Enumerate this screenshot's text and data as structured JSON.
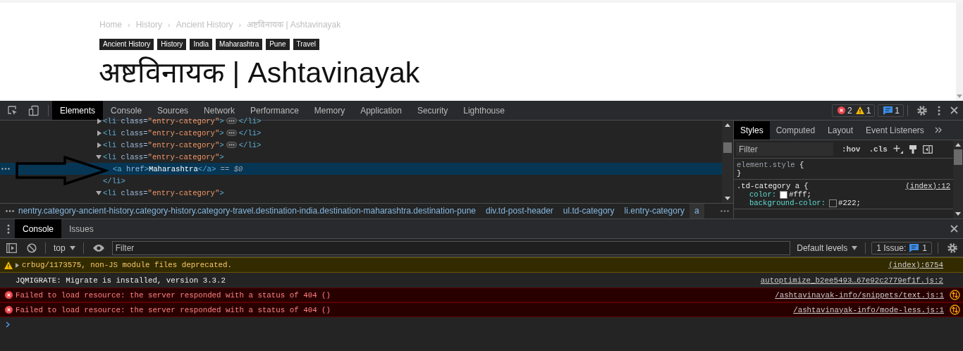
{
  "page": {
    "breadcrumb": {
      "separator": "›",
      "items": [
        "Home",
        "History",
        "Ancient History",
        "अष्टविनायक | Ashtavinayak"
      ]
    },
    "tags": [
      "Ancient History",
      "History",
      "India",
      "Maharashtra",
      "Pune",
      "Travel"
    ],
    "title": "अष्टविनायक | Ashtavinayak"
  },
  "devtools": {
    "tabs": [
      {
        "label": "Elements",
        "selected": true
      },
      {
        "label": "Console",
        "selected": false
      },
      {
        "label": "Sources",
        "selected": false
      },
      {
        "label": "Network",
        "selected": false
      },
      {
        "label": "Performance",
        "selected": false
      },
      {
        "label": "Memory",
        "selected": false
      },
      {
        "label": "Application",
        "selected": false
      },
      {
        "label": "Security",
        "selected": false
      },
      {
        "label": "Lighthouse",
        "selected": false
      }
    ],
    "counters": {
      "errors": "2",
      "warnings": "1",
      "issues": "1"
    },
    "dom": [
      {
        "kind": "collapsed",
        "selected": false,
        "open": [
          {
            "kind": "tag",
            "text": "<li"
          },
          {
            "kind": "attr",
            "text": " class="
          },
          {
            "kind": "value",
            "text": "\"entry-category\""
          },
          {
            "kind": "tag",
            "text": ">"
          }
        ],
        "close": [
          {
            "kind": "tag",
            "text": "</li>"
          }
        ]
      },
      {
        "kind": "collapsed",
        "selected": false,
        "open": [
          {
            "kind": "tag",
            "text": "<li"
          },
          {
            "kind": "attr",
            "text": " class="
          },
          {
            "kind": "value",
            "text": "\"entry-category\""
          },
          {
            "kind": "tag",
            "text": ">"
          }
        ],
        "close": [
          {
            "kind": "tag",
            "text": "</li>"
          }
        ]
      },
      {
        "kind": "collapsed",
        "selected": false,
        "open": [
          {
            "kind": "tag",
            "text": "<li"
          },
          {
            "kind": "attr",
            "text": " class="
          },
          {
            "kind": "value",
            "text": "\"entry-category\""
          },
          {
            "kind": "tag",
            "text": ">"
          }
        ],
        "close": [
          {
            "kind": "tag",
            "text": "</li>"
          }
        ]
      },
      {
        "kind": "expanded",
        "selected": false,
        "open": [
          {
            "kind": "tag",
            "text": "<li"
          },
          {
            "kind": "attr",
            "text": " class="
          },
          {
            "kind": "value",
            "text": "\"entry-category\""
          },
          {
            "kind": "tag",
            "text": ">"
          }
        ],
        "close": [
          {
            "kind": "tag",
            "text": "</li>"
          }
        ],
        "children": [
          {
            "kind": "leaf",
            "selected": true,
            "open": [
              {
                "kind": "tag",
                "text": "<a"
              },
              {
                "kind": "attr",
                "text": " href"
              },
              {
                "kind": "tag",
                "text": ">"
              },
              {
                "kind": "text",
                "text": "Maharashtra"
              },
              {
                "kind": "tag",
                "text": "</a>"
              },
              {
                "kind": "marker",
                "text": " == $0"
              }
            ]
          }
        ]
      },
      {
        "kind": "expanded",
        "selected": false,
        "open": [
          {
            "kind": "tag",
            "text": "<li"
          },
          {
            "kind": "attr",
            "text": " class="
          },
          {
            "kind": "value",
            "text": "\"entry-category\""
          },
          {
            "kind": "tag",
            "text": ">"
          }
        ]
      }
    ],
    "crumbs": [
      {
        "label": "nentry.category-ancient-history.category-history.category-travel.destination-india.destination-maharashtra.destination-pune",
        "selected": false
      },
      {
        "label": "div.td-post-header",
        "selected": false
      },
      {
        "label": "ul.td-category",
        "selected": false
      },
      {
        "label": "li.entry-category",
        "selected": false
      },
      {
        "label": "a",
        "selected": true
      }
    ],
    "styles": {
      "tabs": [
        {
          "label": "Styles",
          "selected": true
        },
        {
          "label": "Computed",
          "selected": false
        },
        {
          "label": "Layout",
          "selected": false
        },
        {
          "label": "Event Listeners",
          "selected": false
        }
      ],
      "filter_placeholder": "Filter",
      "hov": ":hov",
      "cls": ".cls",
      "rules": [
        {
          "selector": "element.style",
          "open": "{",
          "close": "}"
        },
        {
          "selector": ".td-category a",
          "open": "{",
          "source": "(index):12",
          "declarations": [
            {
              "property": "color:",
              "value": "#fff;",
              "color": "#ffffff"
            },
            {
              "property": "background-color:",
              "value": "#222;",
              "color": "#222222"
            }
          ]
        }
      ]
    },
    "drawer": {
      "tabs": [
        {
          "label": "Console",
          "selected": true
        },
        {
          "label": "Issues",
          "selected": false
        }
      ],
      "context": "top",
      "filter_placeholder": "Filter",
      "levels": "Default levels",
      "issues_label": "1 Issue:",
      "issues_count": "1",
      "messages": [
        {
          "kind": "warning",
          "text": "crbug/1173575, non-JS module files deprecated.",
          "source": "(index):6754"
        },
        {
          "kind": "log",
          "text": "JQMIGRATE: Migrate is installed, version 3.3.2",
          "source": "autoptimize_b2ee5493…67e92c2779ef1f.js:2"
        },
        {
          "kind": "error",
          "text": "Failed to load resource: the server responded with a status of 404 ()",
          "source": "/ashtavinayak-info/snippets/text.js:1"
        },
        {
          "kind": "error",
          "text": "Failed to load resource: the server responded with a status of 404 ()",
          "source": "/ashtavinayak-info/mode-less.js:1"
        }
      ]
    }
  }
}
